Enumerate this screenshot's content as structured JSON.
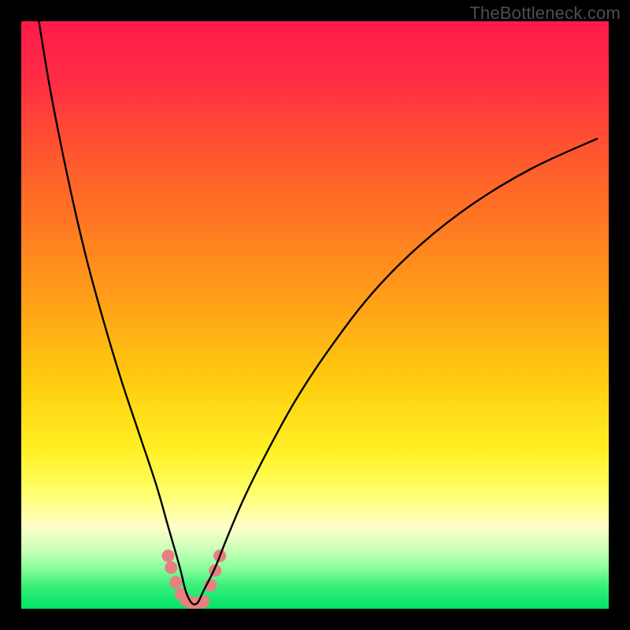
{
  "watermark": "TheBottleneck.com",
  "gradient": {
    "stops": [
      {
        "offset": 0.0,
        "color": "#ff1a4b"
      },
      {
        "offset": 0.1,
        "color": "#ff2d44"
      },
      {
        "offset": 0.22,
        "color": "#ff5530"
      },
      {
        "offset": 0.35,
        "color": "#ff7a22"
      },
      {
        "offset": 0.5,
        "color": "#ffa716"
      },
      {
        "offset": 0.62,
        "color": "#ffcf0f"
      },
      {
        "offset": 0.73,
        "color": "#fff024"
      },
      {
        "offset": 0.8,
        "color": "#ffff68"
      },
      {
        "offset": 0.86,
        "color": "#ffffc8"
      },
      {
        "offset": 0.9,
        "color": "#c8ffb8"
      },
      {
        "offset": 0.93,
        "color": "#8cff9c"
      },
      {
        "offset": 0.96,
        "color": "#3bf07a"
      },
      {
        "offset": 1.0,
        "color": "#00e268"
      }
    ]
  },
  "chart_data": {
    "type": "line",
    "title": "",
    "xlabel": "",
    "ylabel": "",
    "xlim": [
      0,
      100
    ],
    "ylim": [
      0,
      100
    ],
    "note": "Axes are unlabeled in the source image; x and y are normalized 0–100. Curve values are estimated from pixel positions. The curve is a V-shape with its minimum near x≈29.",
    "series": [
      {
        "name": "bottleneck-curve",
        "x": [
          3,
          5,
          8,
          11,
          14,
          17,
          20,
          23,
          25,
          27,
          28,
          29,
          30,
          31,
          33,
          35,
          38,
          42,
          47,
          53,
          60,
          68,
          77,
          87,
          98
        ],
        "y": [
          100,
          88,
          73,
          60,
          49,
          39,
          30,
          21,
          14,
          7,
          3,
          1,
          1,
          3,
          7,
          12,
          19,
          27,
          36,
          45,
          54,
          62,
          69,
          75,
          80
        ]
      }
    ],
    "markers": [
      {
        "name": "cluster-point",
        "x": 25.0,
        "y": 9.0
      },
      {
        "name": "cluster-point",
        "x": 25.5,
        "y": 7.0
      },
      {
        "name": "cluster-point",
        "x": 26.3,
        "y": 4.5
      },
      {
        "name": "cluster-point",
        "x": 27.2,
        "y": 2.5
      },
      {
        "name": "cluster-point",
        "x": 28.0,
        "y": 1.5
      },
      {
        "name": "cluster-point",
        "x": 29.0,
        "y": 1.0
      },
      {
        "name": "cluster-point",
        "x": 30.0,
        "y": 1.0
      },
      {
        "name": "cluster-point",
        "x": 31.0,
        "y": 1.2
      },
      {
        "name": "cluster-point",
        "x": 32.2,
        "y": 4.0
      },
      {
        "name": "cluster-point",
        "x": 33.0,
        "y": 6.5
      },
      {
        "name": "cluster-point",
        "x": 33.8,
        "y": 9.0
      }
    ],
    "marker_style": {
      "color": "#e98080",
      "radius_px": 8
    }
  }
}
